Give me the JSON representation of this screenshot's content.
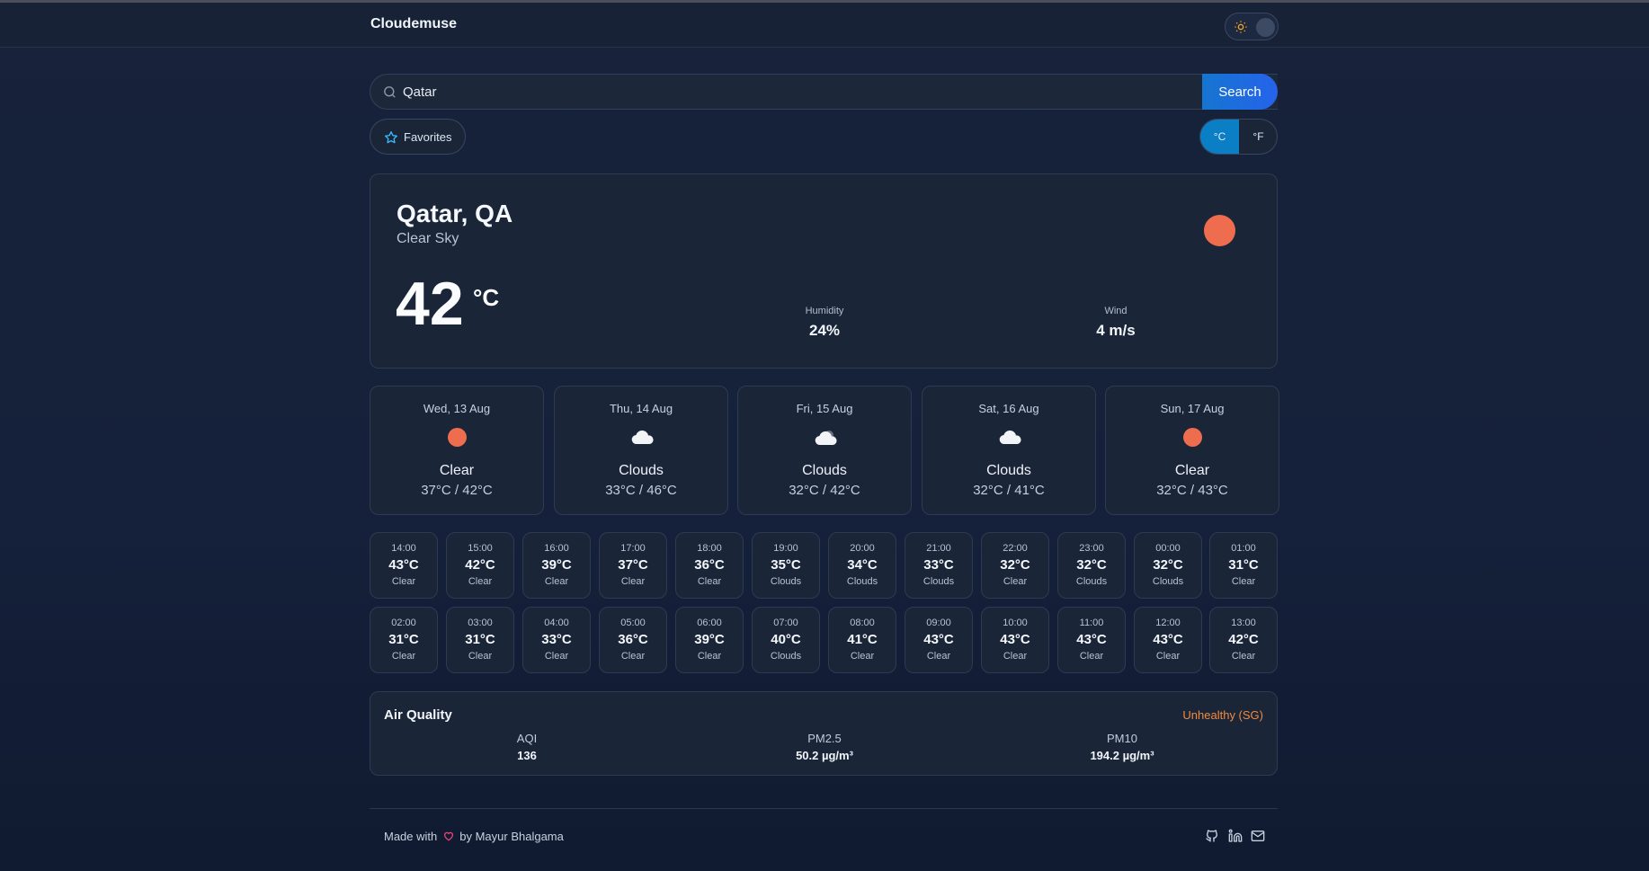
{
  "app": {
    "brand": "Cloudemuse"
  },
  "search": {
    "value": "Qatar",
    "button": "Search"
  },
  "favorites": {
    "label": "Favorites"
  },
  "units": {
    "celsius": "°C",
    "fahrenheit": "°F",
    "selected": "°C"
  },
  "current": {
    "city": "Qatar, QA",
    "condition": "Clear Sky",
    "temp": "42",
    "unit": "°C",
    "humidity_label": "Humidity",
    "humidity": "24%",
    "wind_label": "Wind",
    "wind": "4 m/s",
    "icon": "sun-icon"
  },
  "forecast": [
    {
      "day": "Wed, 13 Aug",
      "cond": "Clear",
      "range": "37°C / 42°C",
      "icon": "sun-icon"
    },
    {
      "day": "Thu, 14 Aug",
      "cond": "Clouds",
      "range": "33°C / 46°C",
      "icon": "cloud-icon"
    },
    {
      "day": "Fri, 15 Aug",
      "cond": "Clouds",
      "range": "32°C / 42°C",
      "icon": "cloud-icon"
    },
    {
      "day": "Sat, 16 Aug",
      "cond": "Clouds",
      "range": "32°C / 41°C",
      "icon": "cloud-icon"
    },
    {
      "day": "Sun, 17 Aug",
      "cond": "Clear",
      "range": "32°C / 43°C",
      "icon": "sun-icon"
    }
  ],
  "hourly": [
    {
      "time": "14:00",
      "temp": "43°C",
      "cond": "Clear"
    },
    {
      "time": "15:00",
      "temp": "42°C",
      "cond": "Clear"
    },
    {
      "time": "16:00",
      "temp": "39°C",
      "cond": "Clear"
    },
    {
      "time": "17:00",
      "temp": "37°C",
      "cond": "Clear"
    },
    {
      "time": "18:00",
      "temp": "36°C",
      "cond": "Clear"
    },
    {
      "time": "19:00",
      "temp": "35°C",
      "cond": "Clouds"
    },
    {
      "time": "20:00",
      "temp": "34°C",
      "cond": "Clouds"
    },
    {
      "time": "21:00",
      "temp": "33°C",
      "cond": "Clouds"
    },
    {
      "time": "22:00",
      "temp": "32°C",
      "cond": "Clear"
    },
    {
      "time": "23:00",
      "temp": "32°C",
      "cond": "Clouds"
    },
    {
      "time": "00:00",
      "temp": "32°C",
      "cond": "Clouds"
    },
    {
      "time": "01:00",
      "temp": "31°C",
      "cond": "Clear"
    },
    {
      "time": "02:00",
      "temp": "31°C",
      "cond": "Clear"
    },
    {
      "time": "03:00",
      "temp": "31°C",
      "cond": "Clear"
    },
    {
      "time": "04:00",
      "temp": "33°C",
      "cond": "Clear"
    },
    {
      "time": "05:00",
      "temp": "36°C",
      "cond": "Clear"
    },
    {
      "time": "06:00",
      "temp": "39°C",
      "cond": "Clear"
    },
    {
      "time": "07:00",
      "temp": "40°C",
      "cond": "Clouds"
    },
    {
      "time": "08:00",
      "temp": "41°C",
      "cond": "Clear"
    },
    {
      "time": "09:00",
      "temp": "43°C",
      "cond": "Clear"
    },
    {
      "time": "10:00",
      "temp": "43°C",
      "cond": "Clear"
    },
    {
      "time": "11:00",
      "temp": "43°C",
      "cond": "Clear"
    },
    {
      "time": "12:00",
      "temp": "43°C",
      "cond": "Clear"
    },
    {
      "time": "13:00",
      "temp": "42°C",
      "cond": "Clear"
    }
  ],
  "air_quality": {
    "title": "Air Quality",
    "status": "Unhealthy (SG)",
    "aqi_label": "AQI",
    "aqi": "136",
    "pm25_label": "PM2.5",
    "pm25": "50.2 µg/m³",
    "pm10_label": "PM10",
    "pm10": "194.2 µg/m³"
  },
  "footer": {
    "made_with": "Made with",
    "by": "by Mayur Bhalgama",
    "links": [
      "github-icon",
      "linkedin-icon",
      "mail-icon"
    ]
  },
  "colors": {
    "accent": "#0b7fc6",
    "sun": "#ef6d4f",
    "warning": "#f28a3e",
    "heart": "#e8457a"
  }
}
